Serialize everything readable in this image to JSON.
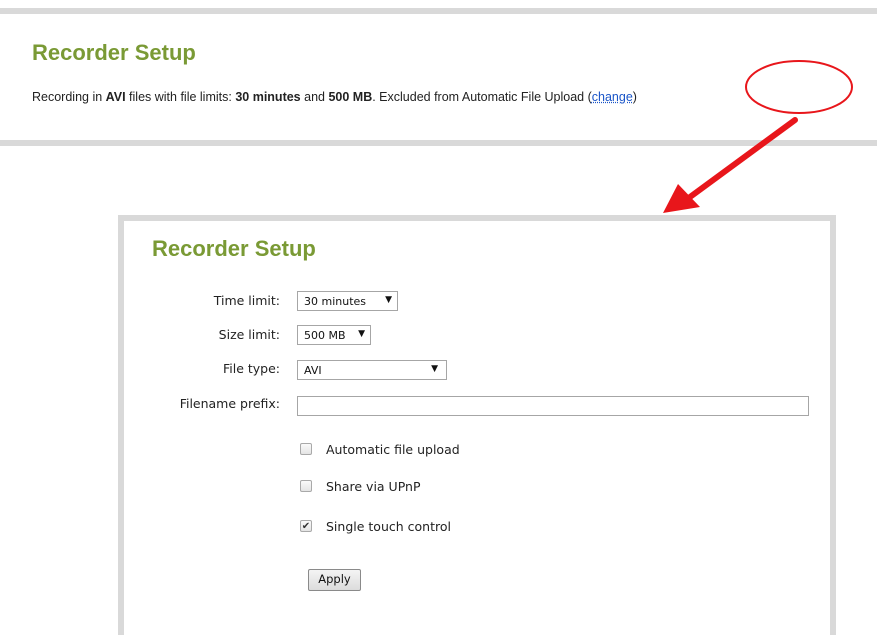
{
  "summary": {
    "title": "Recorder Setup",
    "text_prefix": "Recording in ",
    "format": "AVI",
    "text_mid1": " files with file limits: ",
    "time_limit": "30 minutes",
    "text_and": " and ",
    "size_limit": "500 MB",
    "text_suffix": ". Excluded from Automatic File Upload  (",
    "change_label": "change",
    "close_paren": ")"
  },
  "setup": {
    "title": "Recorder Setup",
    "time_limit_label": "Time limit:",
    "time_limit_value": "30 minutes",
    "size_limit_label": "Size limit:",
    "size_limit_value": "500 MB",
    "file_type_label": "File type:",
    "file_type_value": "AVI",
    "filename_prefix_label": "Filename prefix:",
    "filename_prefix_value": "",
    "options": [
      {
        "label": "Automatic file upload",
        "checked": false
      },
      {
        "label": "Share via UPnP",
        "checked": false
      },
      {
        "label": "Single touch control",
        "checked": true
      }
    ],
    "apply_label": "Apply"
  },
  "annotation": {
    "highlight_color": "#e8161b",
    "arrow_color": "#e8161b"
  },
  "colors": {
    "title_green": "#7a9a35",
    "link_blue": "#1a55c8",
    "panel_border": "#d9d9d9"
  },
  "icons": {
    "dropdown": "triangle-down-icon",
    "check": "checkmark-icon"
  }
}
